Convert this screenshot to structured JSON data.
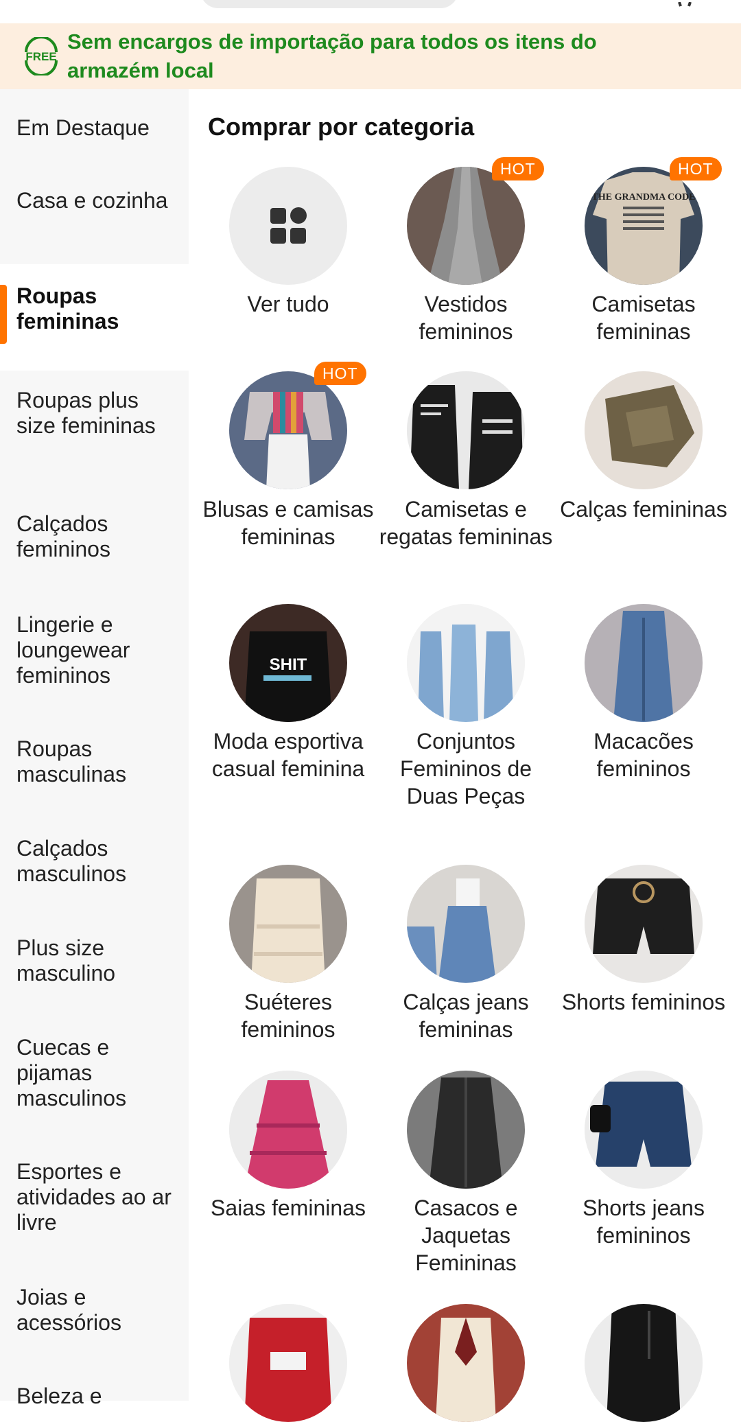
{
  "banner": {
    "badge_text": "FREE",
    "message": "Sem encargos de importação para todos os itens do armazém local",
    "color": "#1e8a1e",
    "background": "#fdeedf"
  },
  "accent_color": "#ff7300",
  "sidebar": {
    "items": [
      {
        "label": "Em Destaque"
      },
      {
        "label": "Casa e cozinha"
      },
      {
        "label": "Roupas femininas",
        "active": true
      },
      {
        "label": "Roupas plus size femininas"
      },
      {
        "label": "Calçados femininos"
      },
      {
        "label": "Lingerie e loungewear femininos"
      },
      {
        "label": "Roupas masculinas"
      },
      {
        "label": "Calçados masculinos"
      },
      {
        "label": "Plus size masculino"
      },
      {
        "label": "Cuecas e pijamas masculinos"
      },
      {
        "label": "Esportes e atividades ao ar livre"
      },
      {
        "label": "Joias e acessórios"
      },
      {
        "label": "Beleza e"
      }
    ]
  },
  "main": {
    "title": "Comprar por categoria",
    "hot_label": "HOT",
    "categories": [
      {
        "label": "Ver tudo",
        "icon": "grid-icon"
      },
      {
        "label": "Vestidos femininos",
        "hot": true
      },
      {
        "label": "Camisetas femininas",
        "hot": true,
        "image_text": "THE GRANDMA CODE"
      },
      {
        "label": "Blusas e camisas femininas",
        "hot": true
      },
      {
        "label": "Camisetas e regatas femininas"
      },
      {
        "label": "Calças femininas"
      },
      {
        "label": "Moda esportiva casual feminina",
        "image_text": "SHIT"
      },
      {
        "label": "Conjuntos Femininos de Duas Peças"
      },
      {
        "label": "Macacões femininos"
      },
      {
        "label": "Suéteres femininos"
      },
      {
        "label": "Calças jeans femininas"
      },
      {
        "label": "Shorts femininos"
      },
      {
        "label": "Saias femininas"
      },
      {
        "label": "Casacos e Jaquetas Femininas"
      },
      {
        "label": "Shorts jeans femininos"
      },
      {
        "label": ""
      },
      {
        "label": ""
      },
      {
        "label": ""
      }
    ]
  }
}
